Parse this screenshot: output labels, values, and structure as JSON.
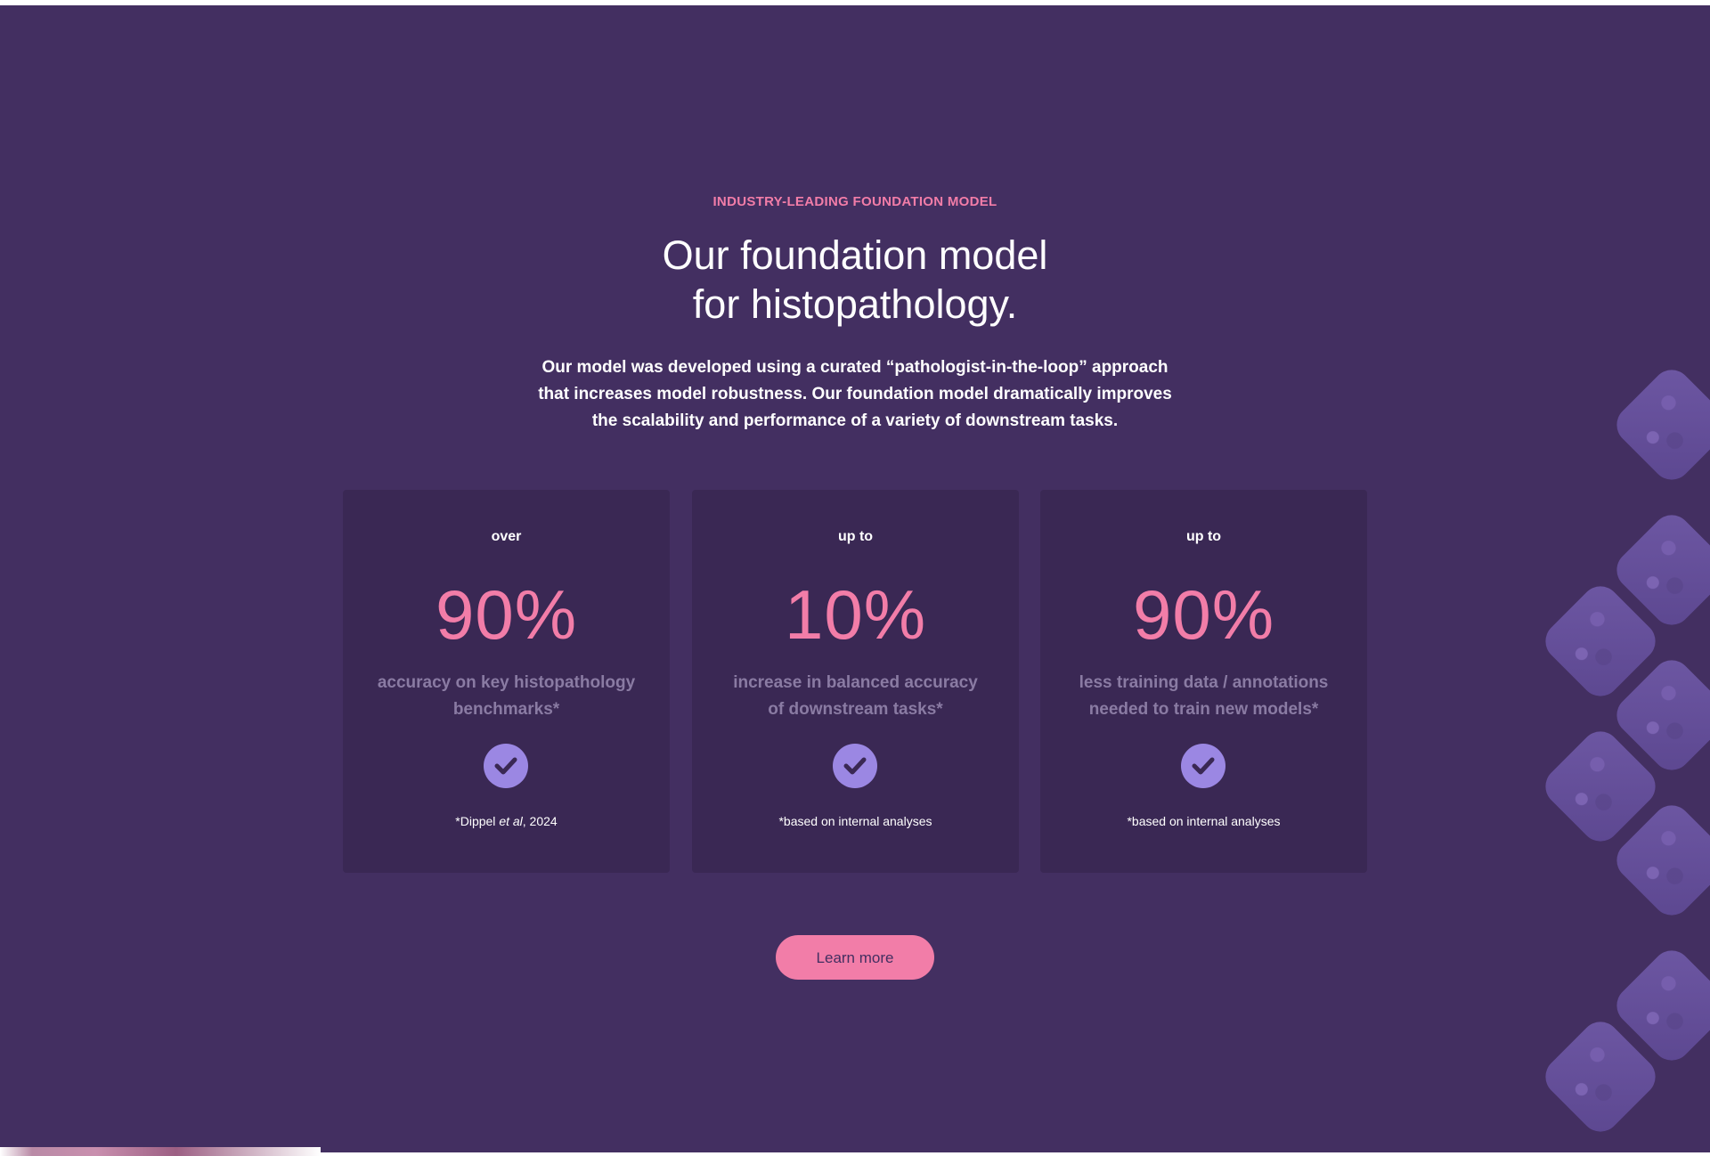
{
  "hero": {
    "eyebrow": "INDUSTRY-LEADING FOUNDATION MODEL",
    "title_line1": "Our foundation model",
    "title_line2": "for histopathology.",
    "lead_line1": "Our model was developed using a curated “pathologist-in-the-loop” approach",
    "lead_line2": "that increases model robustness. Our foundation model dramatically improves",
    "lead_line3": "the scalability and performance of a variety of downstream tasks."
  },
  "stats": [
    {
      "prefix": "over",
      "value": "90%",
      "desc_line1": "accuracy on key histopathology",
      "desc_line2": "benchmarks*",
      "note_before": "*Dippel ",
      "note_italic": "et al",
      "note_after": ", 2024",
      "icon": "check-circle-icon"
    },
    {
      "prefix": "up to",
      "value": "10%",
      "desc_line1": "increase in balanced accuracy",
      "desc_line2": "of downstream tasks*",
      "note_before": "*based on internal analyses",
      "note_italic": "",
      "note_after": "",
      "icon": "check-circle-icon"
    },
    {
      "prefix": "up to",
      "value": "90%",
      "desc_line1": "less training data / annotations",
      "desc_line2": "needed to train new models*",
      "note_before": "*based on internal analyses",
      "note_italic": "",
      "note_after": "",
      "icon": "check-circle-icon"
    }
  ],
  "cta": {
    "label": "Learn more"
  },
  "colors": {
    "background": "#432f61",
    "card": "#3a2854",
    "accent_pink": "#f27da8",
    "check_purple": "#9b87e3",
    "muted_text": "#8a7ba3"
  }
}
